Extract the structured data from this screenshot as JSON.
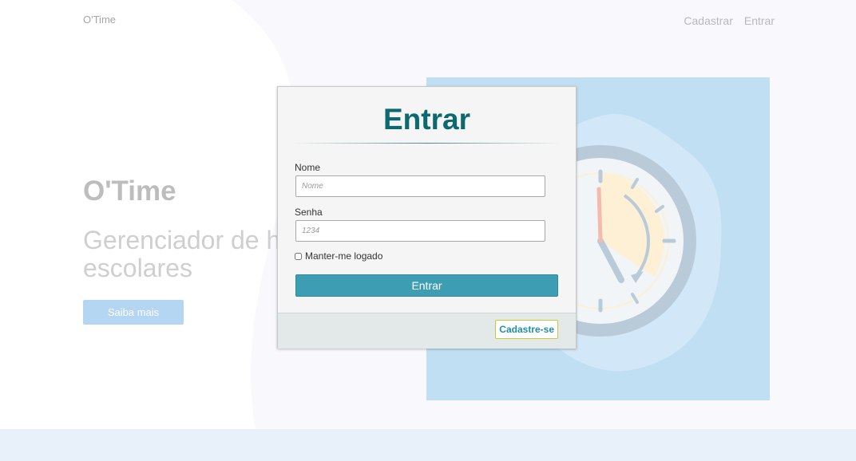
{
  "navbar": {
    "brand": "O'Time",
    "links": [
      "Cadastrar",
      "Entrar"
    ]
  },
  "hero": {
    "title": "O'Time",
    "subtitle_line1": "Gerenciador de h",
    "subtitle_line2": "escolares",
    "button": "Saiba mais"
  },
  "illustration": {
    "icon": "clock-illustration"
  },
  "modal": {
    "title": "Entrar",
    "name_label": "Nome",
    "name_placeholder": "Nome",
    "password_label": "Senha",
    "password_placeholder": "1234",
    "remember_label": "Manter-me logado",
    "remember_checked": false,
    "submit_label": "Entrar",
    "register_label": "Cadastre-se"
  },
  "colors": {
    "accent": "#0d6970",
    "submit": "#3d9eb3",
    "illustration_bg": "#c1dff3"
  }
}
